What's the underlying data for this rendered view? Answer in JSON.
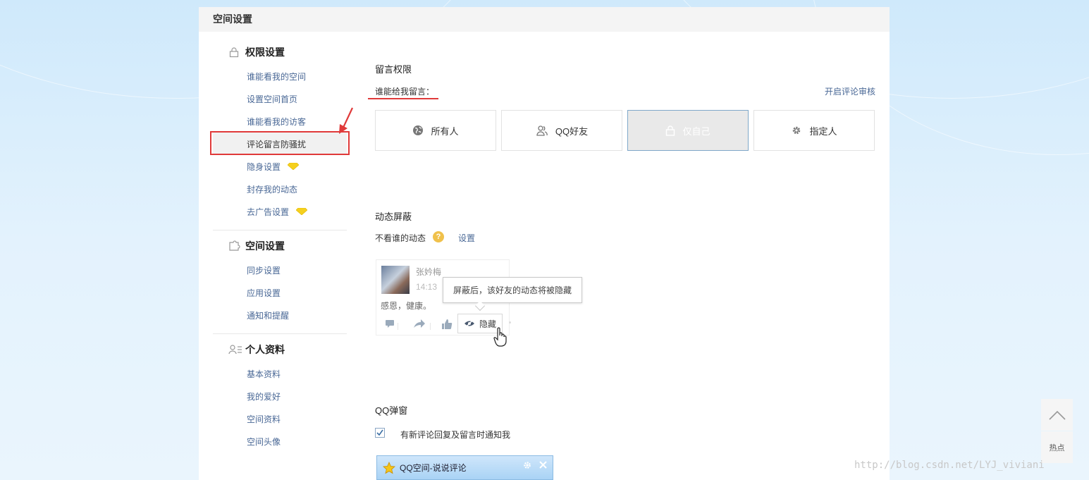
{
  "header": {
    "title": "空间设置"
  },
  "sidebar": {
    "groups": [
      {
        "title": "权限设置",
        "icon": "lock-icon",
        "items": [
          {
            "label": "谁能看我的空间"
          },
          {
            "label": "设置空间首页"
          },
          {
            "label": "谁能看我的访客"
          },
          {
            "label": "评论留言防骚扰",
            "active": true
          },
          {
            "label": "隐身设置",
            "vip": true
          },
          {
            "label": "封存我的动态"
          },
          {
            "label": "去广告设置",
            "vip": true
          }
        ]
      },
      {
        "title": "空间设置",
        "icon": "puzzle-icon",
        "items": [
          {
            "label": "同步设置"
          },
          {
            "label": "应用设置"
          },
          {
            "label": "通知和提醒"
          }
        ]
      },
      {
        "title": "个人资料",
        "icon": "profile-icon",
        "items": [
          {
            "label": "基本资料"
          },
          {
            "label": "我的爱好"
          },
          {
            "label": "空间资料"
          },
          {
            "label": "空间头像"
          }
        ]
      }
    ]
  },
  "message_permission": {
    "title": "留言权限",
    "label": "谁能给我留言：",
    "review_link": "开启评论审核",
    "options": [
      {
        "label": "所有人",
        "icon": "globe-icon"
      },
      {
        "label": "QQ好友",
        "icon": "friends-icon"
      },
      {
        "label": "仅自己",
        "icon": "lock-icon",
        "selected": true
      },
      {
        "label": "指定人",
        "icon": "gear-icon"
      }
    ]
  },
  "feed_block": {
    "title": "动态屏蔽",
    "label": "不看谁的动态",
    "help": "?",
    "settings_link": "设置",
    "example": {
      "name": "张妗梅",
      "time": "14:13",
      "text": "感恩，健康。",
      "tooltip": "屏蔽后，该好友的动态将被隐藏",
      "hide_label": "隐藏"
    }
  },
  "qq_popup": {
    "title": "QQ弹窗",
    "checkbox_label": "有新评论回复及留言时通知我",
    "checked": true,
    "popup_title": "QQ空间-说说评论"
  },
  "float_tools": {
    "hot_label": "热点"
  },
  "watermark": "http://blog.csdn.net/LYJ_viviani",
  "colors": {
    "link": "#4a6896",
    "highlight": "#e03a3a",
    "selected_border": "#7fa7c9",
    "vip": "#f5d01e"
  }
}
